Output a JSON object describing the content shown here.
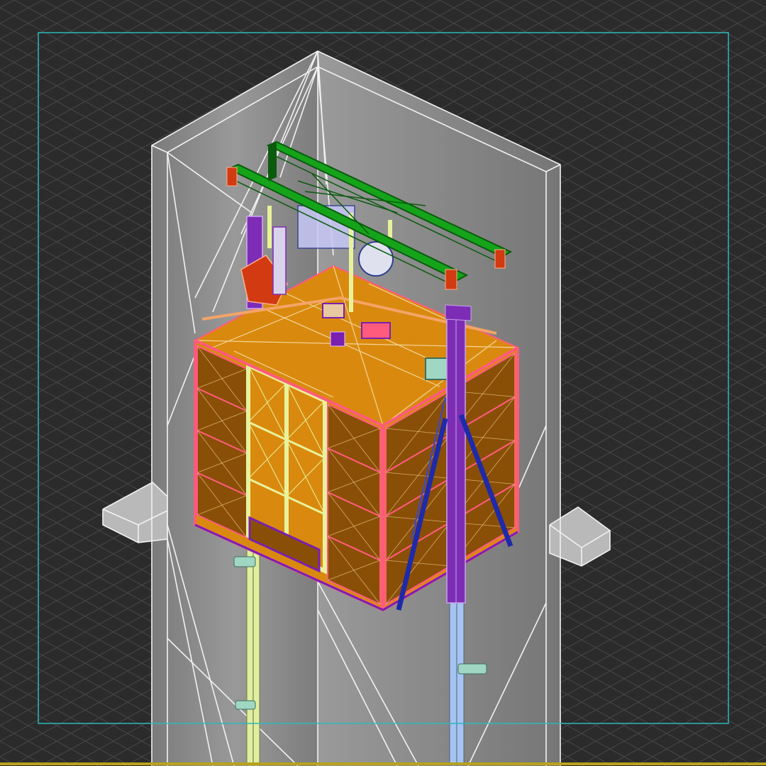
{
  "viewport": {
    "background_color": "#2b2b2b",
    "grid_color": "#5a5a5a",
    "safe_frame_color": "#2fb7bd",
    "ground_line_color": "#b7a21d"
  },
  "model": {
    "shaft_wire_color": "#f2f2f2",
    "shaft_fill_color": "#8c8c8c",
    "cabin_panel_color": "#d98a0e",
    "cabin_panel_dark_color": "#8a4f06",
    "cabin_frame_color": "#ff5b7d",
    "cabin_outline_color": "#7a1fb0",
    "door_frame_color": "#e8f29b",
    "beam_color": "#15a31a",
    "beam_dark_color": "#0b5a0e",
    "mast_color": "#7d2db5",
    "strut_color": "#1f2aa8",
    "rail_left_color": "#dfeea0",
    "rail_right_color": "#a6c4f0",
    "hoist_color": "#d23a12",
    "panel_cross_color": "#f4d59a",
    "bracket_color": "#9fd7c2"
  }
}
